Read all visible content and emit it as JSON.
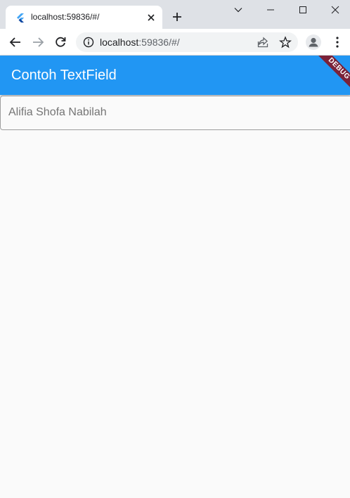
{
  "browser": {
    "tab": {
      "title": "localhost:59836/#/",
      "favicon": "flutter-icon"
    },
    "new_tab": "plus-icon",
    "window_controls": [
      "chevron-down-icon",
      "minimize-icon",
      "maximize-icon",
      "close-icon"
    ],
    "toolbar": {
      "url_host": "localhost",
      "url_path": ":59836/#/",
      "icons": [
        "back-icon",
        "forward-icon",
        "reload-icon",
        "info-icon",
        "share-icon",
        "star-icon",
        "profile-icon",
        "more-icon"
      ]
    }
  },
  "app": {
    "appbar_title": "Contoh TextField",
    "appbar_color": "#2196f3",
    "debug_banner": "DEBUG",
    "textfield": {
      "placeholder": "Alifia Shofa Nabilah"
    }
  }
}
